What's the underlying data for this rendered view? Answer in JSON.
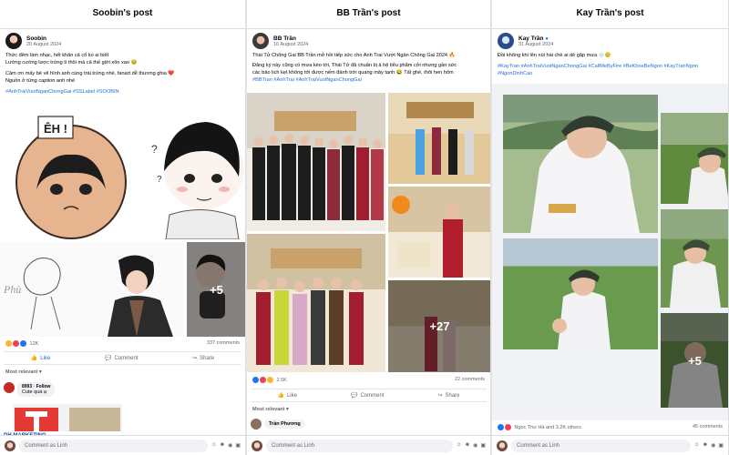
{
  "panel1": {
    "title": "Soobin's post",
    "author": "Soobin",
    "date": "20 August 2024",
    "text_lines": [
      "Thức đêm làm nhạc, hết khăn cả cổ ko ai biết",
      "Lướng cướng lược trứng tí thôi mà cả thế giới xôn xao 🥹",
      "Cảm ơn mấy bé vẽ hình anh cùng trái trứng nhé, fanart dễ thương ghia ❤️",
      "Nguồn ở từng caption anh nhé"
    ],
    "hashtags": "#AnhTraiVuotNganChongGai #SSLabel #SOOBIN",
    "egg_text": "ÊH !",
    "sketch_text": "Phù",
    "more_photos": "+5",
    "reactions": "12K",
    "comments": "337 comments",
    "like": "Like",
    "comment": "Comment",
    "share": "Share",
    "most_relevant": "Most relevant ▾",
    "commenter": "8993 · Follow",
    "comment_text": "Cute quá ạ",
    "comment_name": "DH MARKETING",
    "comment_placeholder": "Comment as Linh"
  },
  "panel2": {
    "title": "BB Trần's post",
    "author": "BB Trần",
    "date": "16 August 2024",
    "text_lines": [
      "Thái Tử Chông Gai BB Trần mở hồi tiếp sức cho Anh Trai Vượt Ngàn Chông Gai 2024 🔥",
      "Đăng ký này cũng có mưa kéo tới, Thái Tử đã chuẩn bị ả hệ tiểu phẩm cởi nhưng gần sức",
      "các bảo lịch kẹt không tới được nếm đánh trời quang mây tạnh 😂 Tất ghé, thôi hen hôm"
    ],
    "hashtags": "#BBTran #AnhTrai #AnhTraiVuotNganChongGai",
    "more_photos": "+27",
    "reactions": "2.5K",
    "comments": "22 comments",
    "like": "Like",
    "comment": "Comment",
    "share": "Share",
    "most_relevant": "Most relevant ▾",
    "commenter": "Trần Phương",
    "comment_placeholder": "Comment as Linh"
  },
  "panel3": {
    "title": "Kay Trần's post",
    "author": "Kay Trần",
    "date": "31 August 2024",
    "text_lines": [
      "Đồi không khi lên núi hái chè ai dè gặp mưa 🌧️🥲"
    ],
    "hashtags": "#KayTran #AnhTraiVuotNganChongGai #CallMeByFire #BeKhoeBeNgon #KayTranNgon #NgonDinhCao",
    "more_photos": "+5",
    "reactions": "Ngọc Thư Hà and 3.2K others",
    "comments": "45 comments",
    "comment_placeholder": "Comment as Linh"
  }
}
